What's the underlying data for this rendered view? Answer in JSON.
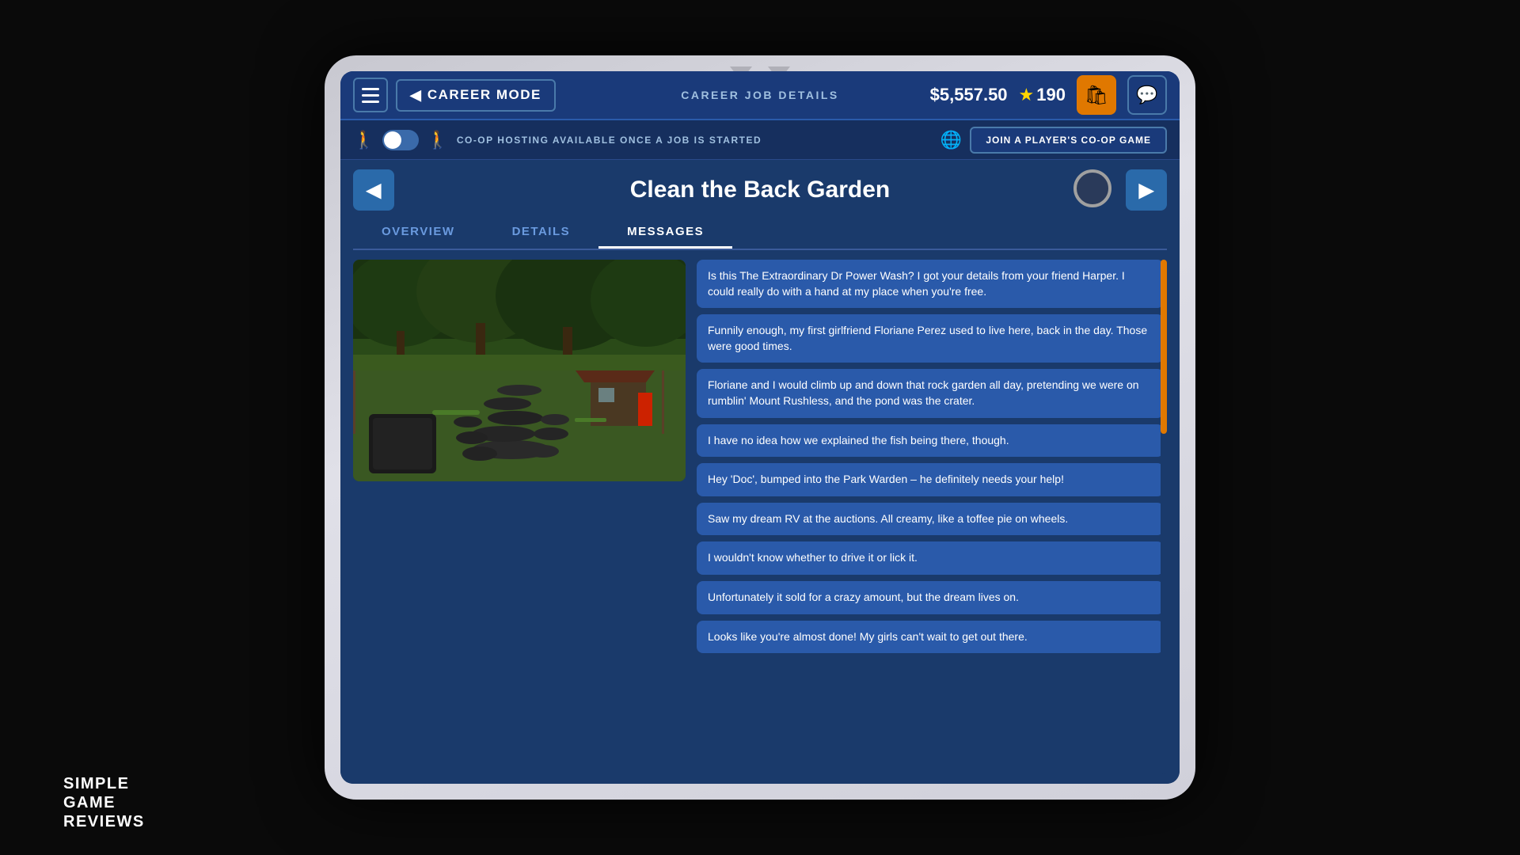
{
  "tablet": {
    "notch": {
      "triangles": [
        "▼",
        "▼"
      ]
    }
  },
  "header": {
    "menu_label": "☰",
    "back_arrow": "◀",
    "career_mode_label": "CAREER MODE",
    "center_label": "CAREER JOB DETAILS",
    "currency": "$5,557.50",
    "stars_icon": "★",
    "stars_value": "190",
    "shop_icon": "🛍",
    "chat_icon": "💬"
  },
  "coop_bar": {
    "player_icon": "🚶",
    "player_icon2": "🚶",
    "toggle_state": false,
    "text": "CO-OP HOSTING AVAILABLE ONCE A JOB IS STARTED",
    "globe_icon": "🌐",
    "join_button_label": "JOIN A PLAYER'S CO-OP GAME"
  },
  "job": {
    "title": "Clean the Back Garden",
    "prev_arrow": "◀",
    "next_arrow": "▶"
  },
  "tabs": [
    {
      "id": "overview",
      "label": "OVERVIEW",
      "active": false
    },
    {
      "id": "details",
      "label": "DETAILS",
      "active": false
    },
    {
      "id": "messages",
      "label": "MESSAGES",
      "active": true
    }
  ],
  "messages": [
    {
      "id": 1,
      "text": "Is this The Extraordinary Dr Power Wash? I got your details from your friend Harper. I could really do with a hand at my place when you're free."
    },
    {
      "id": 2,
      "text": "Funnily enough, my first girlfriend Floriane Perez used to live here, back in the day. Those were good times."
    },
    {
      "id": 3,
      "text": "Floriane and I would climb up and down that rock garden all day, pretending we were on rumblin' Mount Rushless, and the pond was the crater."
    },
    {
      "id": 4,
      "text": "I have no idea how we explained the fish being there, though."
    },
    {
      "id": 5,
      "text": "Hey 'Doc', bumped into the Park Warden – he definitely needs your help!"
    },
    {
      "id": 6,
      "text": "Saw my dream RV at the auctions. All creamy, like a toffee pie on wheels."
    },
    {
      "id": 7,
      "text": "I wouldn't know whether to drive it or lick it."
    },
    {
      "id": 8,
      "text": "Unfortunately it sold for a crazy amount, but the dream lives on."
    },
    {
      "id": 9,
      "text": "Looks like you're almost done! My girls can't wait to get out there."
    }
  ],
  "logo": {
    "line1": "SIMPLE",
    "line2": "GAME",
    "line3": "REVIEWS"
  }
}
